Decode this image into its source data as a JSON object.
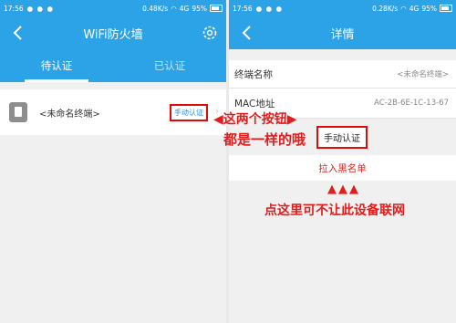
{
  "status_left": {
    "time": "17:56",
    "speed": "0.48K/s",
    "network": "4G",
    "battery": "95%"
  },
  "status_right": {
    "time": "17:56",
    "speed": "0.28K/s",
    "network": "4G",
    "battery": "95%"
  },
  "left_screen": {
    "title": "WiFi防火墙",
    "tabs": [
      "待认证",
      "已认证"
    ],
    "device_name": "<未命名终端>",
    "manual_button": "手动认证"
  },
  "right_screen": {
    "title": "详情",
    "rows": [
      {
        "label": "终端名称",
        "value": "<未命名终端>"
      },
      {
        "label": "MAC地址",
        "value": "AC-2B-6E-1C-13-67"
      }
    ],
    "manual_button": "手动认证",
    "blacklist": "拉入黑名单"
  },
  "annotations": {
    "same_buttons_line1": "◀这两个按钮▶",
    "same_buttons_line2": "都是一样的哦",
    "arrows": "▲▲▲",
    "block_hint": "点这里可不让此设备联网"
  },
  "colors": {
    "accent": "#2ca3e6",
    "annotation": "#e11d1d"
  },
  "icons": {
    "back": "chevron-left-icon",
    "settings": "gear-icon",
    "device": "phone-icon"
  }
}
